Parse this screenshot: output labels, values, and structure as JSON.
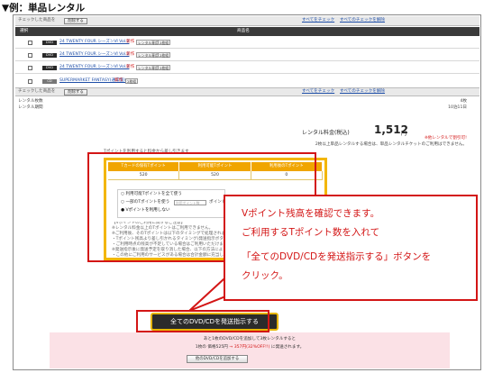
{
  "heading": "▼例：単品レンタル",
  "toolbar_top": {
    "check_label": "チェックした商品を",
    "delete_button": "削除する",
    "check_all": "すべてをチェック",
    "uncheck_all": "すべてのチェックを解除"
  },
  "table_header": {
    "col_select": "選択",
    "col_product": "商品名"
  },
  "items": [
    {
      "badge": "DVD",
      "title": "24 TWENTY FOUR シーズンⅥ Vol.2",
      "new": "新作",
      "tags": [
        "レンタル専用",
        "2枚組"
      ]
    },
    {
      "badge": "DVD",
      "title": "24 TWENTY FOUR シーズンⅥ Vol.2",
      "new": "新作",
      "tags": [
        "レンタル専用",
        "2枚組"
      ]
    },
    {
      "badge": "DVD",
      "title": "24 TWENTY FOUR シーズンⅥ Vol.2",
      "new": "新作",
      "tags": [
        "レンタル専用",
        "2枚組"
      ]
    },
    {
      "badge": "DVD",
      "title": "24 TWENTY FOUR シーズンⅥ Vol.2",
      "new": "新作",
      "tags": [
        "レンタル専用",
        "2枚組"
      ]
    },
    {
      "badge": "CD",
      "title": "SUPERMARKET FANTASY(通常盤)",
      "new": "新作",
      "tags": [
        "2枚組"
      ]
    }
  ],
  "toolbar_bottom": {
    "check_label": "チェックした商品を",
    "delete_button": "削除する",
    "check_all": "すべてをチェック",
    "uncheck_all": "すべてのチェックを解除"
  },
  "summary": {
    "count_label": "レンタル枚数",
    "count_value": "4枚",
    "period_label": "レンタル期間",
    "period_value": "10泊11日",
    "fee_label": "レンタル料金(税込)",
    "fee_value": "1,512",
    "fee_unit": "円",
    "fee_note": "※他レンタルで割引可!",
    "warning": "2枚以上単品レンタルする場合は、単品レンタルチケットのご利用はできません。"
  },
  "points": {
    "intro": "Tポイントを利用すると料金から差し引きます",
    "headers": [
      "Tカードの保有Tポイント",
      "利用可能Tポイント",
      "利用後のTポイント"
    ],
    "values": [
      "520",
      "520",
      "0"
    ],
    "options": [
      {
        "label": "○ 利用可能Tポイントを全て使う",
        "selected": false
      },
      {
        "label": "○ 一部のTポイントを使う",
        "selected": false
      },
      {
        "label": "● Vポイントを利用しない",
        "selected": true
      }
    ],
    "input_placeholder": "利用ポイント数",
    "input_unit": "ポイント",
    "notes": [
      "【Vポイントのご利用に関するご注意】",
      "※レンタル料金以上のTポイントはご利用できません。",
      "※ご利用後、そのTポイントは以下のタイミングで処理されます。",
      "・Tポイント残高より差し引かれるタイミング(発送指示ボタン押下時)",
      "・ご利用時点の残高が不足している場合はご利用いただけません",
      "※発送指示後に発送予定を取り消した場合、以下の方法によりTポイントを返還します。",
      "・この他にご利用のサービスがある場合は合計金額に充当します",
      "・この他にご利用のサービスがない場合は返還(翌月ご請求時)します"
    ]
  },
  "callout": {
    "line1": "Vポイント残高を確認できます。",
    "line2": "ご利用するTポイント数を入れて",
    "line3": "「全てのDVD/CDを発送指示する」ボタンを",
    "line4": "クリック。"
  },
  "ship_button": "全てのDVD/CDを発送指示する",
  "promo": {
    "line1": "あと1枚のDVD/CDを追加して3枚レンタルすると",
    "line2_prefix": "1枚の 価格525円",
    "line2_arrow": "→",
    "line2_after": "357円(32%OFF!!)",
    "line2_suffix": "に発送されます。",
    "add_button": "他のDVD/CDを追加する"
  },
  "colors": {
    "accent_red": "#d31515",
    "points_orange": "#f0a500",
    "button_border": "#e6b400",
    "promo_pink": "#fbe1e6"
  }
}
